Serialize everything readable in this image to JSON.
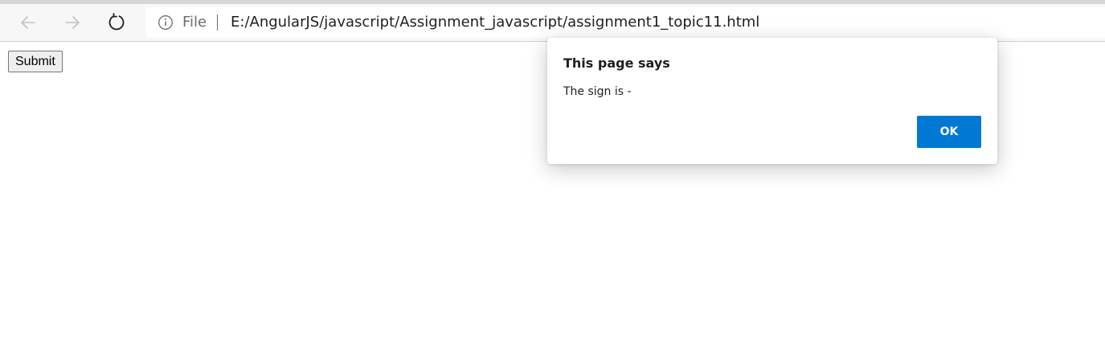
{
  "browser": {
    "nav": {
      "back_icon": "arrow-left-icon",
      "forward_icon": "arrow-right-icon",
      "reload_icon": "reload-icon"
    },
    "address": {
      "info_icon": "info-icon",
      "scheme_label": "File",
      "url": "E:/AngularJS/javascript/Assignment_javascript/assignment1_topic11.html"
    }
  },
  "page": {
    "submit_label": "Submit"
  },
  "dialog": {
    "title": "This page says",
    "message": "The sign is -",
    "ok_label": "OK",
    "accent_color": "#0078d4"
  }
}
